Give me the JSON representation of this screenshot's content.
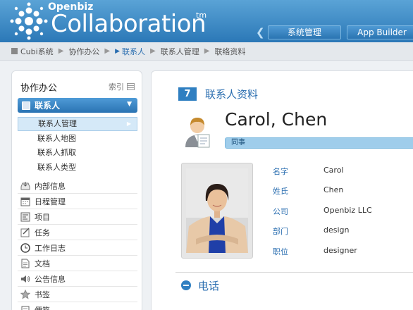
{
  "header": {
    "brand_small": "Openbiz",
    "brand_big": "Collaboration",
    "brand_tm": "tm",
    "buttons": [
      "系统管理",
      "App Builder"
    ]
  },
  "breadcrumb": [
    "Cubi系统",
    "协作办公",
    "联系人",
    "联系人管理",
    "联络资料"
  ],
  "sidebar": {
    "title": "协作办公",
    "index_label": "索引",
    "category": "联系人",
    "subitems": [
      "联系人管理",
      "联系人地图",
      "联系人抓取",
      "联系人类型"
    ],
    "nav": [
      {
        "label": "内部信息",
        "icon": "inbox-icon"
      },
      {
        "label": "日程管理",
        "icon": "calendar-icon"
      },
      {
        "label": "项目",
        "icon": "project-icon"
      },
      {
        "label": "任务",
        "icon": "task-icon"
      },
      {
        "label": "工作日志",
        "icon": "clock-icon"
      },
      {
        "label": "文档",
        "icon": "document-icon"
      },
      {
        "label": "公告信息",
        "icon": "speaker-icon"
      },
      {
        "label": "书签",
        "icon": "star-icon"
      },
      {
        "label": "便签",
        "icon": "note-icon"
      }
    ]
  },
  "main": {
    "section_number": "7",
    "section_title": "联系人资料",
    "contact_name": "Carol, Chen",
    "tag": "同事",
    "fields": [
      {
        "label": "名字",
        "value": "Carol"
      },
      {
        "label": "姓氏",
        "value": "Chen"
      },
      {
        "label": "公司",
        "value": "Openbiz LLC"
      },
      {
        "label": "部门",
        "value": "design"
      },
      {
        "label": "职位",
        "value": "designer"
      }
    ],
    "phone_section": "电话"
  },
  "colors": {
    "accent": "#2f7fc1",
    "header": "#3a8ac7"
  }
}
